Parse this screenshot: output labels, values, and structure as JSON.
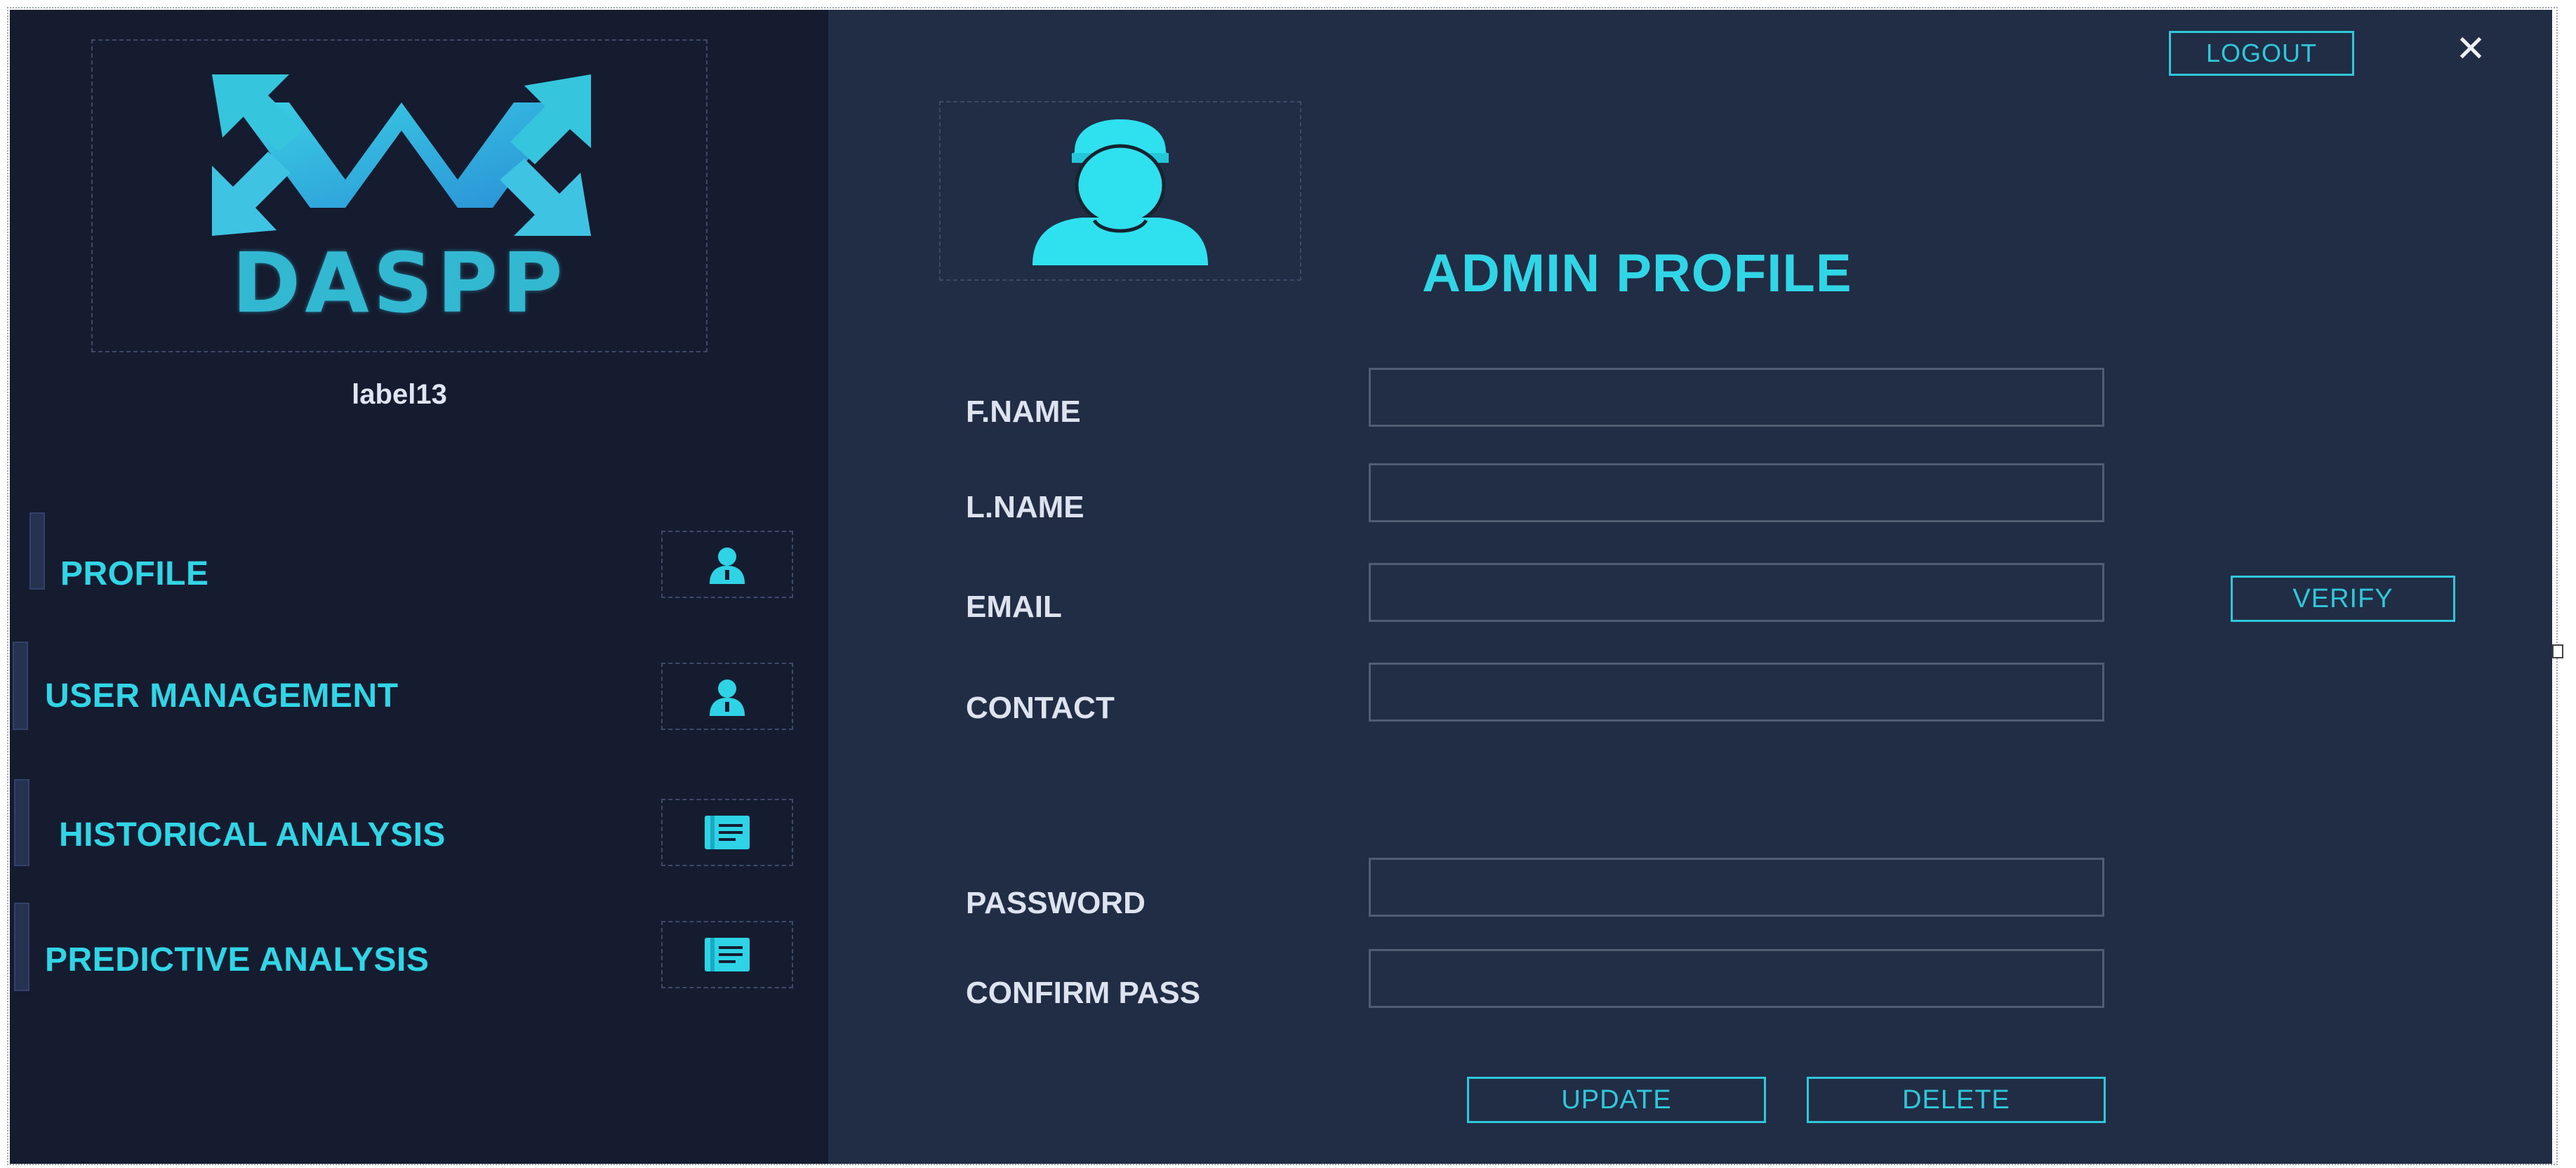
{
  "window": {
    "close_label": "✕"
  },
  "colors": {
    "sidebar_bg": "#161c30",
    "main_bg": "#212d44",
    "accent": "#31d6e6",
    "label_text": "#dde4ef"
  },
  "sidebar": {
    "logo_text": "DASPP",
    "user_label": "label13",
    "items": [
      {
        "label": "PROFILE",
        "icon": "user-icon"
      },
      {
        "label": "USER MANAGEMENT",
        "icon": "user-icon"
      },
      {
        "label": "HISTORICAL ANALYSIS",
        "icon": "document-icon"
      },
      {
        "label": "PREDICTIVE ANALYSIS",
        "icon": "document-icon"
      }
    ]
  },
  "header": {
    "logout_label": "LOGOUT",
    "page_title": "ADMIN PROFILE",
    "avatar_icon": "user-avatar-icon"
  },
  "form": {
    "fields": [
      {
        "label": "F.NAME",
        "value": ""
      },
      {
        "label": "L.NAME",
        "value": ""
      },
      {
        "label": "EMAIL",
        "value": ""
      },
      {
        "label": "CONTACT",
        "value": ""
      },
      {
        "label": "PASSWORD",
        "value": ""
      },
      {
        "label": "CONFIRM PASS",
        "value": ""
      }
    ],
    "verify_label": "VERIFY",
    "update_label": "UPDATE",
    "delete_label": "DELETE"
  }
}
